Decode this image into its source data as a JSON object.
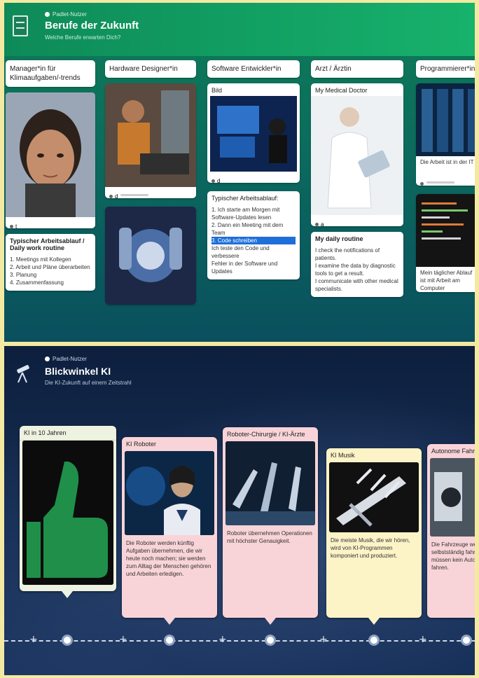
{
  "panel1": {
    "author": "Padlet-Nutzer",
    "title": "Berufe der Zukunft",
    "subtitle": "Welche Berufe erwarten Dich?",
    "columns": [
      {
        "heading": "Manager*in für Klimaaufgaben/-trends",
        "cards": [
          {
            "image": "portrait-woman",
            "caption": "t"
          },
          {
            "title": "Typischer Arbeitsablauf / Daily work routine",
            "text": "1. Meetings mit Kollegen\n2. Arbeit und Pläne überarbeiten\n3. Planung\n4. Zusammenfassung"
          }
        ]
      },
      {
        "heading": "Hardware Designer*in",
        "cards": [
          {
            "image": "engineer-lab",
            "caption": "d"
          },
          {
            "image": "robot-lab"
          }
        ]
      },
      {
        "heading": "Software Entwickler*in",
        "cards": [
          {
            "title": "Bild",
            "image": "developer-screens",
            "caption": "d"
          },
          {
            "title": "Typischer Arbeitsablauf:",
            "text_lines": [
              "1. Ich starte am Morgen mit",
              "Software-Updates lesen",
              "2. Dann ein Meeting mit dem Team",
              "3. Code schreiben",
              "Ich teste den Code und verbessere",
              "Fehler in der Software und",
              "Updates"
            ],
            "highlight": "Code schreiben"
          }
        ]
      },
      {
        "heading": "Arzt / Ärztin",
        "cards": [
          {
            "title": "My Medical Doctor",
            "image": "doctor-tablet",
            "caption": "a"
          },
          {
            "title": "My daily routine",
            "text": "I check the notifications of patients.\nI examine the data by diagnostic tools to get a result.\nI communicate with other medical specialists."
          }
        ]
      },
      {
        "heading": "Programmierer*in",
        "cards": [
          {
            "image": "server-room",
            "caption": "Die Arbeit ist in der IT"
          },
          {
            "image": "code-screen",
            "text": "Mein täglicher Ablauf ist mit Arbeit am Computer"
          }
        ]
      }
    ]
  },
  "panel2": {
    "author": "Padlet-Nutzer",
    "title": "Blickwinkel KI",
    "subtitle": "Die KI-Zukunft auf einem Zeitstrahl",
    "cards": [
      {
        "title": "KI in 10 Jahren",
        "image": "thumbs-up",
        "color": "#eef2e0"
      },
      {
        "title": "KI Roboter",
        "image": "humanoid-robot",
        "text": "Die Roboter werden künftig Aufgaben übernehmen, die wir heute noch machen; sie werden zum Alltag der Menschen gehören und Arbeiten erledigen.",
        "color": "#f8d4d8"
      },
      {
        "title": "Roboter-Chirurgie / KI-Ärzte",
        "image": "robotic-surgery",
        "text": "Roboter übernehmen Operationen mit höchster Genauigkeit.",
        "color": "#f8d4d8"
      },
      {
        "title": "KI Musik",
        "image": "robot-piano",
        "text": "Die meiste Musik, die wir hören, wird von KI-Programmen komponiert und produziert.",
        "color": "#fcf3c7"
      },
      {
        "title": "Autonome Fahrzeuge",
        "image": "self-driving-car",
        "text": "Die Fahrzeuge werden selbstständig fahren. Menschen müssen kein Auto mehr selbst fahren.",
        "color": "#f8d4d8"
      }
    ]
  }
}
